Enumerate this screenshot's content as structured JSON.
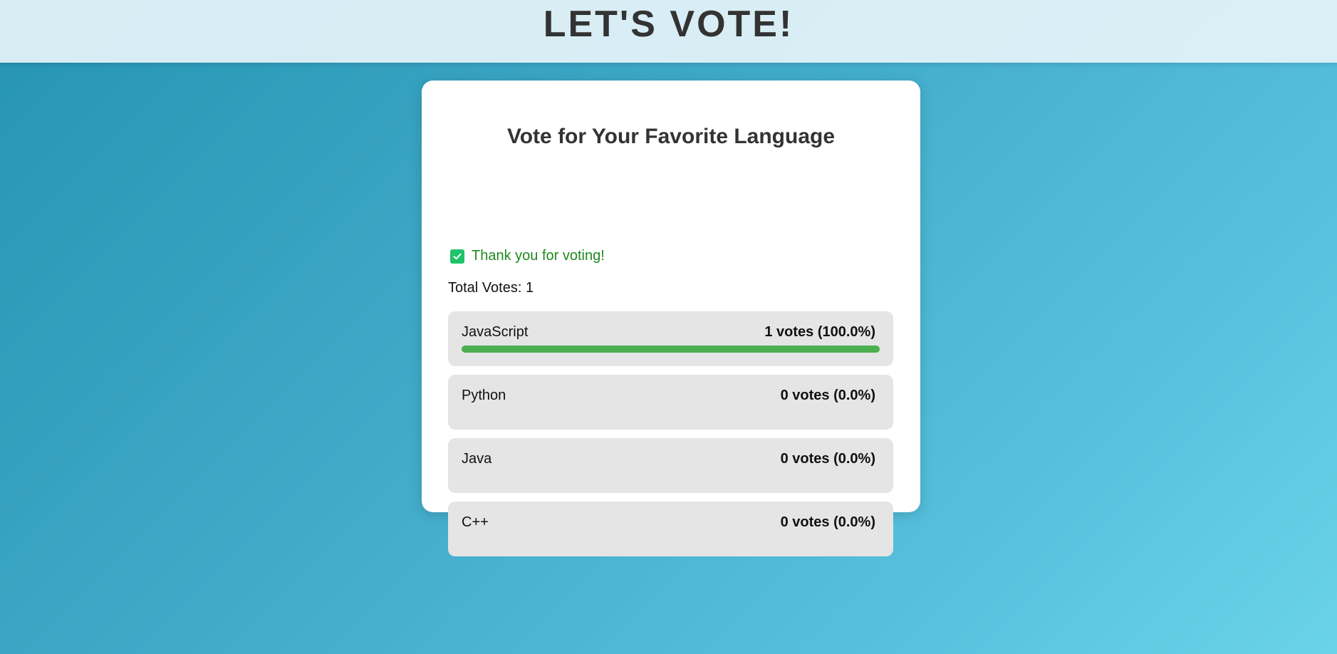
{
  "header": {
    "title": "LET'S VOTE!"
  },
  "poll": {
    "title": "Vote for Your Favorite Language",
    "success_message": "Thank you for voting!",
    "total_votes_text": "Total Votes: 1",
    "options": [
      {
        "name": "JavaScript",
        "votes_text": "1 votes (100.0%)",
        "votes": 1,
        "percent": 100.0
      },
      {
        "name": "Python",
        "votes_text": "0 votes (0.0%)",
        "votes": 0,
        "percent": 0.0
      },
      {
        "name": "Java",
        "votes_text": "0 votes (0.0%)",
        "votes": 0,
        "percent": 0.0
      },
      {
        "name": "C++",
        "votes_text": "0 votes (0.0%)",
        "votes": 0,
        "percent": 0.0
      }
    ]
  },
  "colors": {
    "bar_fill": "#4caf50",
    "success_check": "#1fc46a",
    "success_text": "#1e8a1e"
  },
  "icons": {
    "success": "check-box-icon"
  }
}
